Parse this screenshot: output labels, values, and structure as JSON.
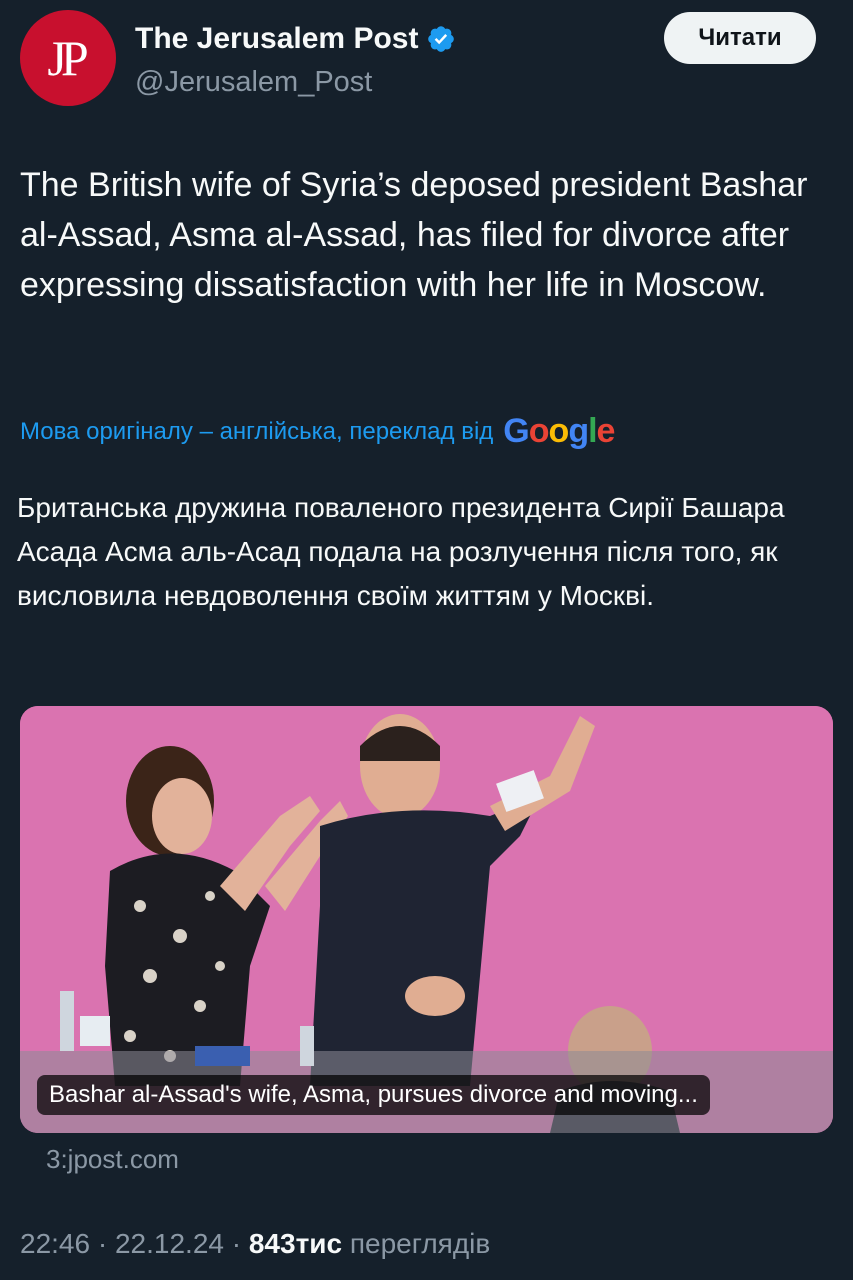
{
  "account": {
    "avatar_text": "JP",
    "name": "The Jerusalem Post",
    "handle": "@Jerusalem_Post",
    "verified_icon": "verified-badge-icon",
    "follow_label": "Читати"
  },
  "tweet": {
    "text": "The British wife of Syria’s deposed president Bashar al-Assad, Asma al-Assad, has filed for divorce after expressing dissatisfaction with her life in Moscow.",
    "translation_note": "Мова оригіналу – англійська, переклад від",
    "translation_provider": "Google",
    "translated_text": "Британська дружина поваленого президента Сирії Башара Асада Асма аль-Асад подала на розлучення після того, як висловила невдоволення своїм життям у Москві."
  },
  "media": {
    "caption": "Bashar al-Assad's wife, Asma, pursues divorce and moving...",
    "source": "3:jpost.com"
  },
  "meta": {
    "time": "22:46",
    "separator": "·",
    "date": "22.12.24",
    "views_count": "843тис",
    "views_label": "переглядів"
  },
  "colors": {
    "background": "#15202b",
    "accent": "#1d9bf0",
    "avatar_bg": "#c8102e"
  }
}
